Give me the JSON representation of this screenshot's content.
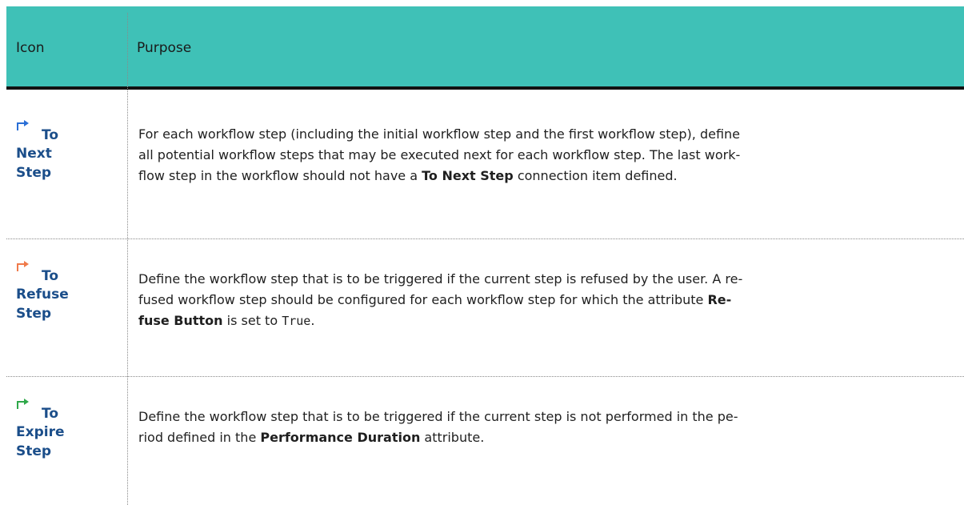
{
  "header": {
    "col_icon": "Icon",
    "col_purpose": "Purpose"
  },
  "rows": [
    {
      "icon": "arrow-corner-right-blue-icon",
      "icon_color": "#2a6fd6",
      "label_first": "To",
      "label_rest": [
        "Next",
        "Step"
      ],
      "text": {
        "l1": "For each workflow step (including the initial workflow step and the first workflow step), define",
        "l2": "all potential workflow steps that may be executed next for each workflow step. The last work-",
        "l3a": "flow step in the workflow should not have a ",
        "l3b": "To Next Step",
        "l3c": " connection item defined."
      }
    },
    {
      "icon": "arrow-corner-right-orange-icon",
      "icon_color": "#f07a4a",
      "label_first": "To",
      "label_rest": [
        "Refuse",
        "Step"
      ],
      "text": {
        "l1": "Define the workflow step that is to be triggered if the current step is refused by the user. A re-",
        "l2a": "fused workflow step should be configured for each workflow step for which the attribute ",
        "l2b": "Re-",
        "l3a": "fuse Button",
        "l3b": " is set to ",
        "l3c": "True",
        "l3d": "."
      }
    },
    {
      "icon": "arrow-corner-right-green-icon",
      "icon_color": "#2fa84a",
      "label_first": "To",
      "label_rest": [
        "Expire",
        "Step"
      ],
      "text": {
        "l1": "Define the workflow step that is to be triggered if the current step is not performed in the pe-",
        "l2a": "riod defined in the ",
        "l2b": "Performance Duration",
        "l2c": " attribute."
      }
    }
  ]
}
